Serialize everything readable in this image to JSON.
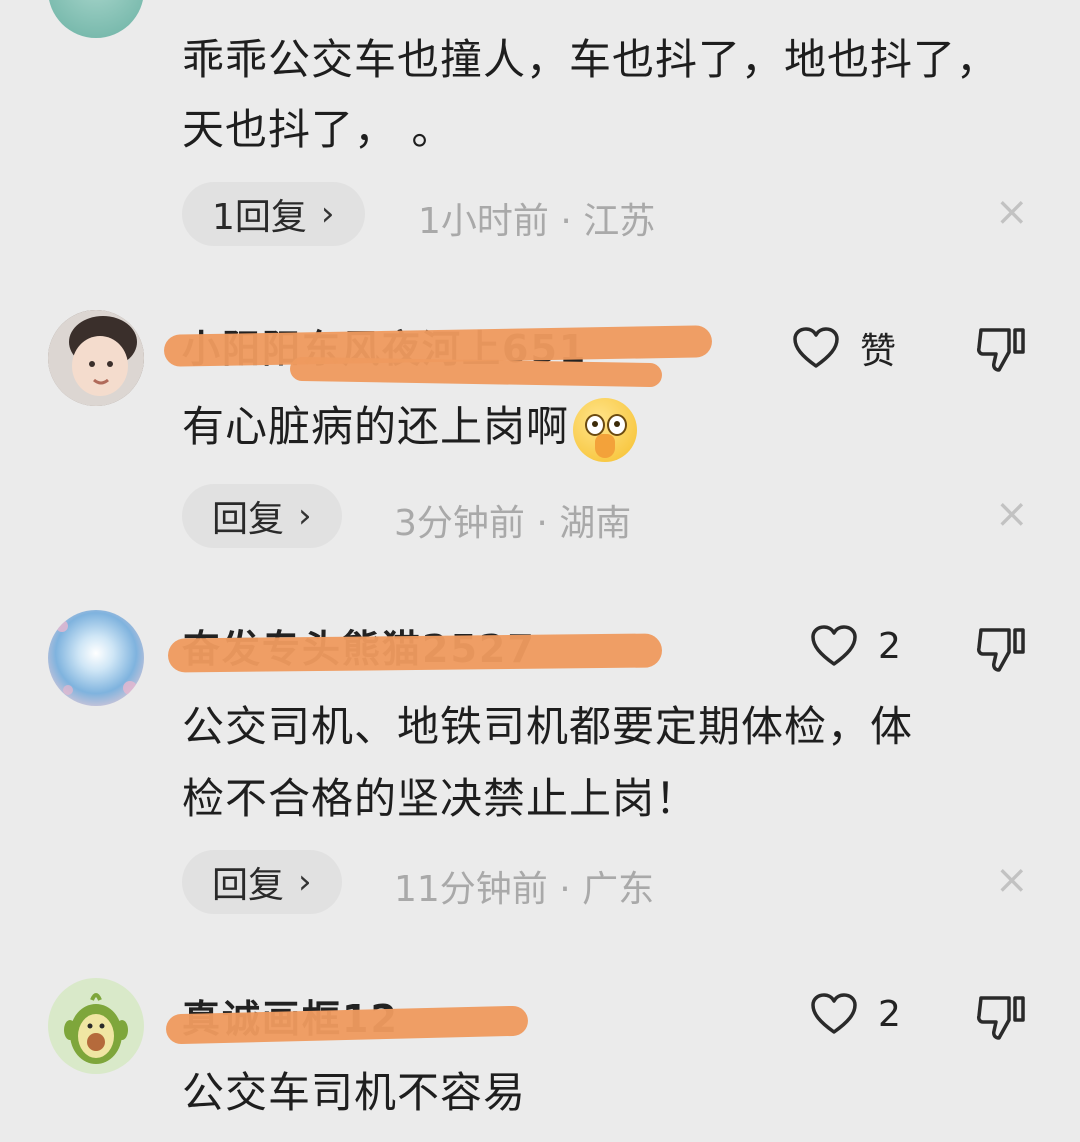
{
  "comments": [
    {
      "text_lines": [
        "乖乖公交车也撞人，车也抖了，地也抖了，",
        "天也抖了，  。"
      ],
      "reply_label": "1回复",
      "time": "1小时前",
      "location": "江苏"
    },
    {
      "username": "小阳阳东风夜河上651",
      "like_label": "赞",
      "text": "有心脏病的还上岗啊",
      "reply_label": "回复",
      "time": "3分钟前",
      "location": "湖南"
    },
    {
      "username": "奋发专头熊猫2527",
      "like_count": "2",
      "text_lines": [
        "公交司机、地铁司机都要定期体检，体",
        "检不合格的坚决禁止上岗！"
      ],
      "reply_label": "回复",
      "time": "11分钟前",
      "location": "广东"
    },
    {
      "username": "真诚画框12",
      "like_count": "2",
      "text": "公交车司机不容易"
    }
  ],
  "separator": " · ",
  "chevron": "›",
  "close_glyph": "×",
  "colors": {
    "background": "#ebebeb",
    "redaction": "#ee9a5f",
    "meta_text": "#a9a9a9"
  },
  "icons": [
    "heart-icon",
    "thumbs-down-icon",
    "close-icon",
    "chevron-right-icon"
  ]
}
